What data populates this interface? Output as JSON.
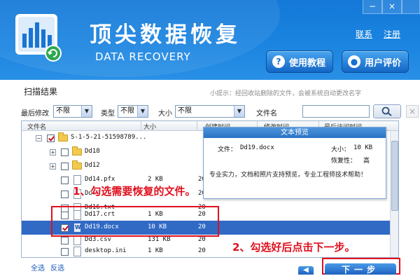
{
  "header": {
    "title_cn": "顶尖数据恢复",
    "title_en": "DATA RECOVERY",
    "link_contact": "联系",
    "link_register": "注册",
    "btn_tutorial": "使用教程",
    "btn_review": "用户评价",
    "min_btn": "−",
    "close_btn": "×"
  },
  "results": {
    "title": "扫描结果",
    "tip": "小提示：经回收站删除的文件，会被系统自动更改名字"
  },
  "filters": {
    "last_modified_label": "最后修改",
    "last_modified_value": "不限",
    "type_label": "类型",
    "type_value": "不限",
    "size_label": "大小",
    "size_value": "不限",
    "filename_label": "文件名",
    "filename_value": ""
  },
  "columns": {
    "name": "文件名",
    "size": "大小",
    "created": "创建时间",
    "modified": "修改时间",
    "accessed": "最后访问时间"
  },
  "rows": [
    {
      "name": "S-1-5-21-51598789...",
      "size": ""
    },
    {
      "name": "Dd18",
      "size": ""
    },
    {
      "name": "Dd12",
      "size": ""
    },
    {
      "name": "Dd14.pfx",
      "size": "2 KB",
      "created": "20"
    },
    {
      "name": "Dd17",
      "size": "",
      "created": "20"
    },
    {
      "name": "Dd16.txt",
      "size": "",
      "created": "20"
    },
    {
      "name": "Dd17.crt",
      "size": "1 KB",
      "created": "20"
    },
    {
      "name": "Dd19.docx",
      "size": "10 KB",
      "created": "20"
    },
    {
      "name": "Dd3.csv",
      "size": "131 KB",
      "created": "20"
    },
    {
      "name": "desktop.ini",
      "size": "1 KB",
      "created": "20"
    }
  ],
  "preview": {
    "title": "文本预览",
    "file_label": "文件：",
    "file_name": "Dd19.docx",
    "size_label": "大小：",
    "size_value": "10 KB",
    "recover_label": "恢复性：",
    "recover_value": "高",
    "description": "专业实力，文档和照片支持预览，专业工程师技术帮助！"
  },
  "annotations": {
    "step1": "1、勾选需要恢复的文件。",
    "step2": "2、勾选好后点击下一步。"
  },
  "footer": {
    "select_all": "全选",
    "invert": "反选",
    "prev_btn": "◀",
    "next_btn": "下一步"
  }
}
